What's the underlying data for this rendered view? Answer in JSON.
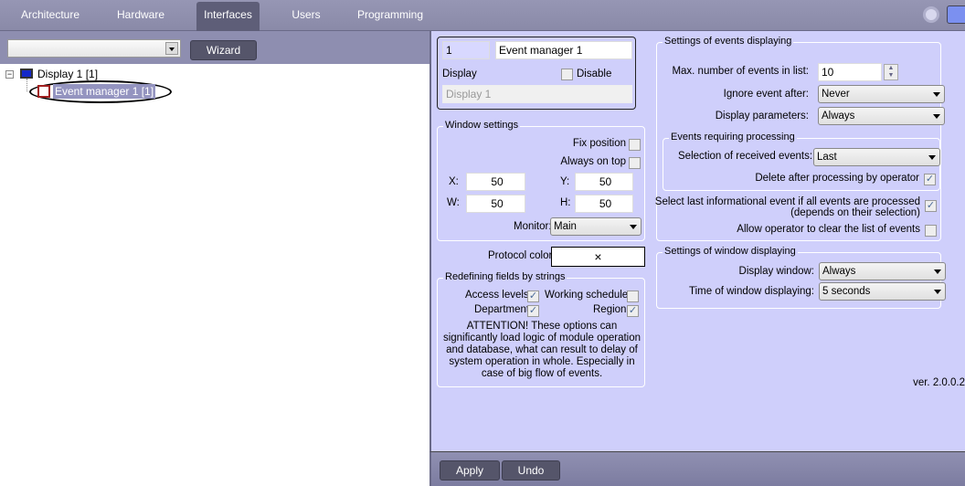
{
  "tabs": [
    "Architecture",
    "Hardware",
    "Interfaces",
    "Users",
    "Programming"
  ],
  "active_tab": "Interfaces",
  "toolbar": {
    "wizard_label": "Wizard",
    "object_select": ""
  },
  "tree": {
    "root": "Display 1 [1]",
    "child": "Event manager 1 [1]"
  },
  "object": {
    "id": "1",
    "name": "Event manager 1",
    "display_label": "Display",
    "disable_label": "Disable",
    "disable_checked": false,
    "display_value": "Display 1"
  },
  "window_settings": {
    "title": "Window settings",
    "fix_position": "Fix position",
    "always_on_top": "Always on top",
    "x_label": "X:",
    "x": "50",
    "y_label": "Y:",
    "y": "50",
    "w_label": "W:",
    "w": "50",
    "h_label": "H:",
    "h": "50",
    "monitor_label": "Monitor:",
    "monitor": "Main"
  },
  "protocol": {
    "label": "Protocol color:",
    "value": "×"
  },
  "redefining": {
    "title": "Redefining fields by strings",
    "access_levels": "Access levels",
    "working_schedule": "Working schedule",
    "department": "Department",
    "region": "Region",
    "attention": "ATTENTION! These options can significantly load logic of module operation and database, what can result to delay of system operation in whole. Especially in case of big flow of events."
  },
  "events_displaying": {
    "title": "Settings of events displaying",
    "max_label": "Max. number of events in list:",
    "max_value": "10",
    "ignore_label": "Ignore event after:",
    "ignore_value": "Never",
    "params_label": "Display parameters:",
    "params_value": "Always"
  },
  "requiring": {
    "title": "Events requiring processing",
    "selection_label": "Selection of received events:",
    "selection_value": "Last",
    "delete_label": "Delete after processing by operator"
  },
  "select_last": {
    "line1": "Select last informational event if all events are processed",
    "line2": "(depends on their selection)"
  },
  "allow_clear": "Allow operator to clear the list of events",
  "window_displaying": {
    "title": "Settings of window displaying",
    "display_label": "Display window:",
    "display_value": "Always",
    "time_label": "Time of window displaying:",
    "time_value": "5 seconds"
  },
  "version": "ver. 2.0.0.2",
  "buttons": {
    "apply": "Apply",
    "undo": "Undo"
  }
}
